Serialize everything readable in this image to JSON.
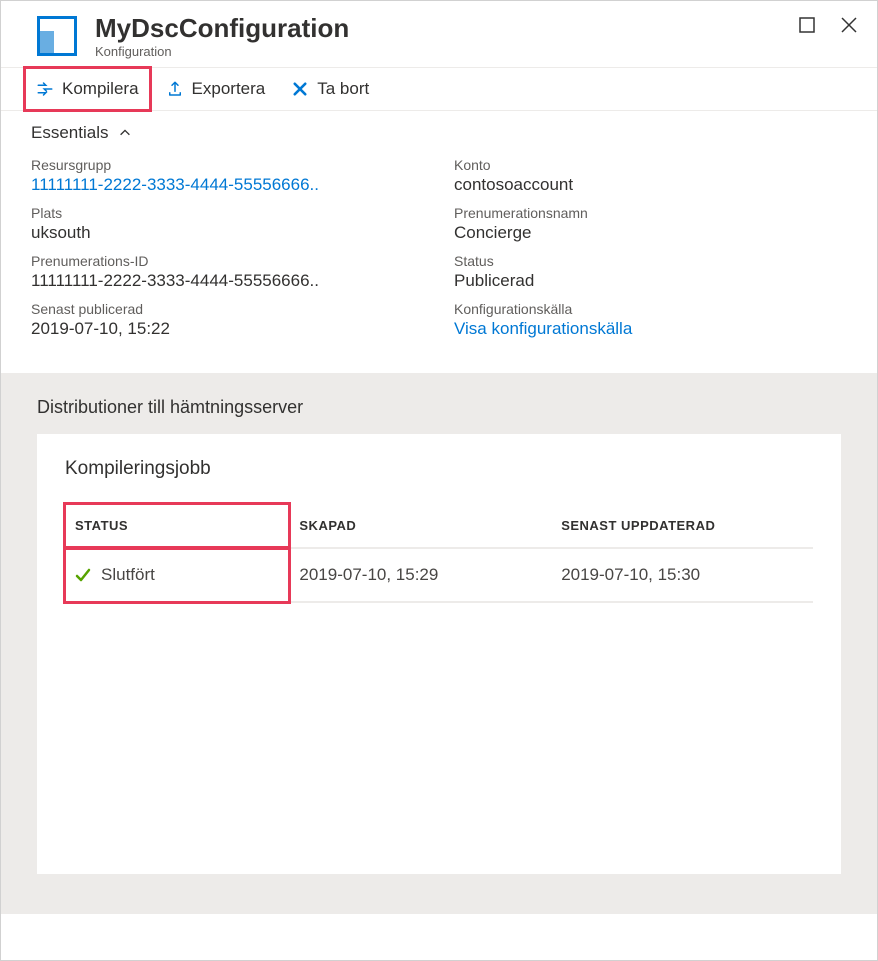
{
  "header": {
    "title": "MyDscConfiguration",
    "subtitle": "Konfiguration"
  },
  "toolbar": {
    "compile": "Kompilera",
    "export": "Exportera",
    "delete": "Ta bort"
  },
  "essentials": {
    "header": "Essentials",
    "resource_group_label": "Resursgrupp",
    "resource_group_value": "11111111-2222-3333-4444-55556666..",
    "account_label": "Konto",
    "account_value": "contosoaccount",
    "location_label": "Plats",
    "location_value": "uksouth",
    "subscription_name_label": "Prenumerationsnamn",
    "subscription_name_value": "Concierge",
    "subscription_id_label": "Prenumerations-ID",
    "subscription_id_value": "11111111-2222-3333-4444-55556666..",
    "status_label": "Status",
    "status_value": "Publicerad",
    "last_published_label": "Senast publicerad",
    "last_published_value": "2019-07-10, 15:22",
    "config_source_label": "Konfigurationskälla",
    "config_source_value": "Visa konfigurationskälla"
  },
  "section": {
    "title": "Distributioner till hämtningsserver",
    "card_title": "Kompileringsjobb"
  },
  "table": {
    "columns": {
      "status": "STATUS",
      "created": "SKAPAD",
      "updated": "SENAST UPPDATERAD"
    },
    "rows": [
      {
        "status": "Slutfört",
        "created": "2019-07-10, 15:29",
        "updated": "2019-07-10, 15:30"
      }
    ]
  }
}
